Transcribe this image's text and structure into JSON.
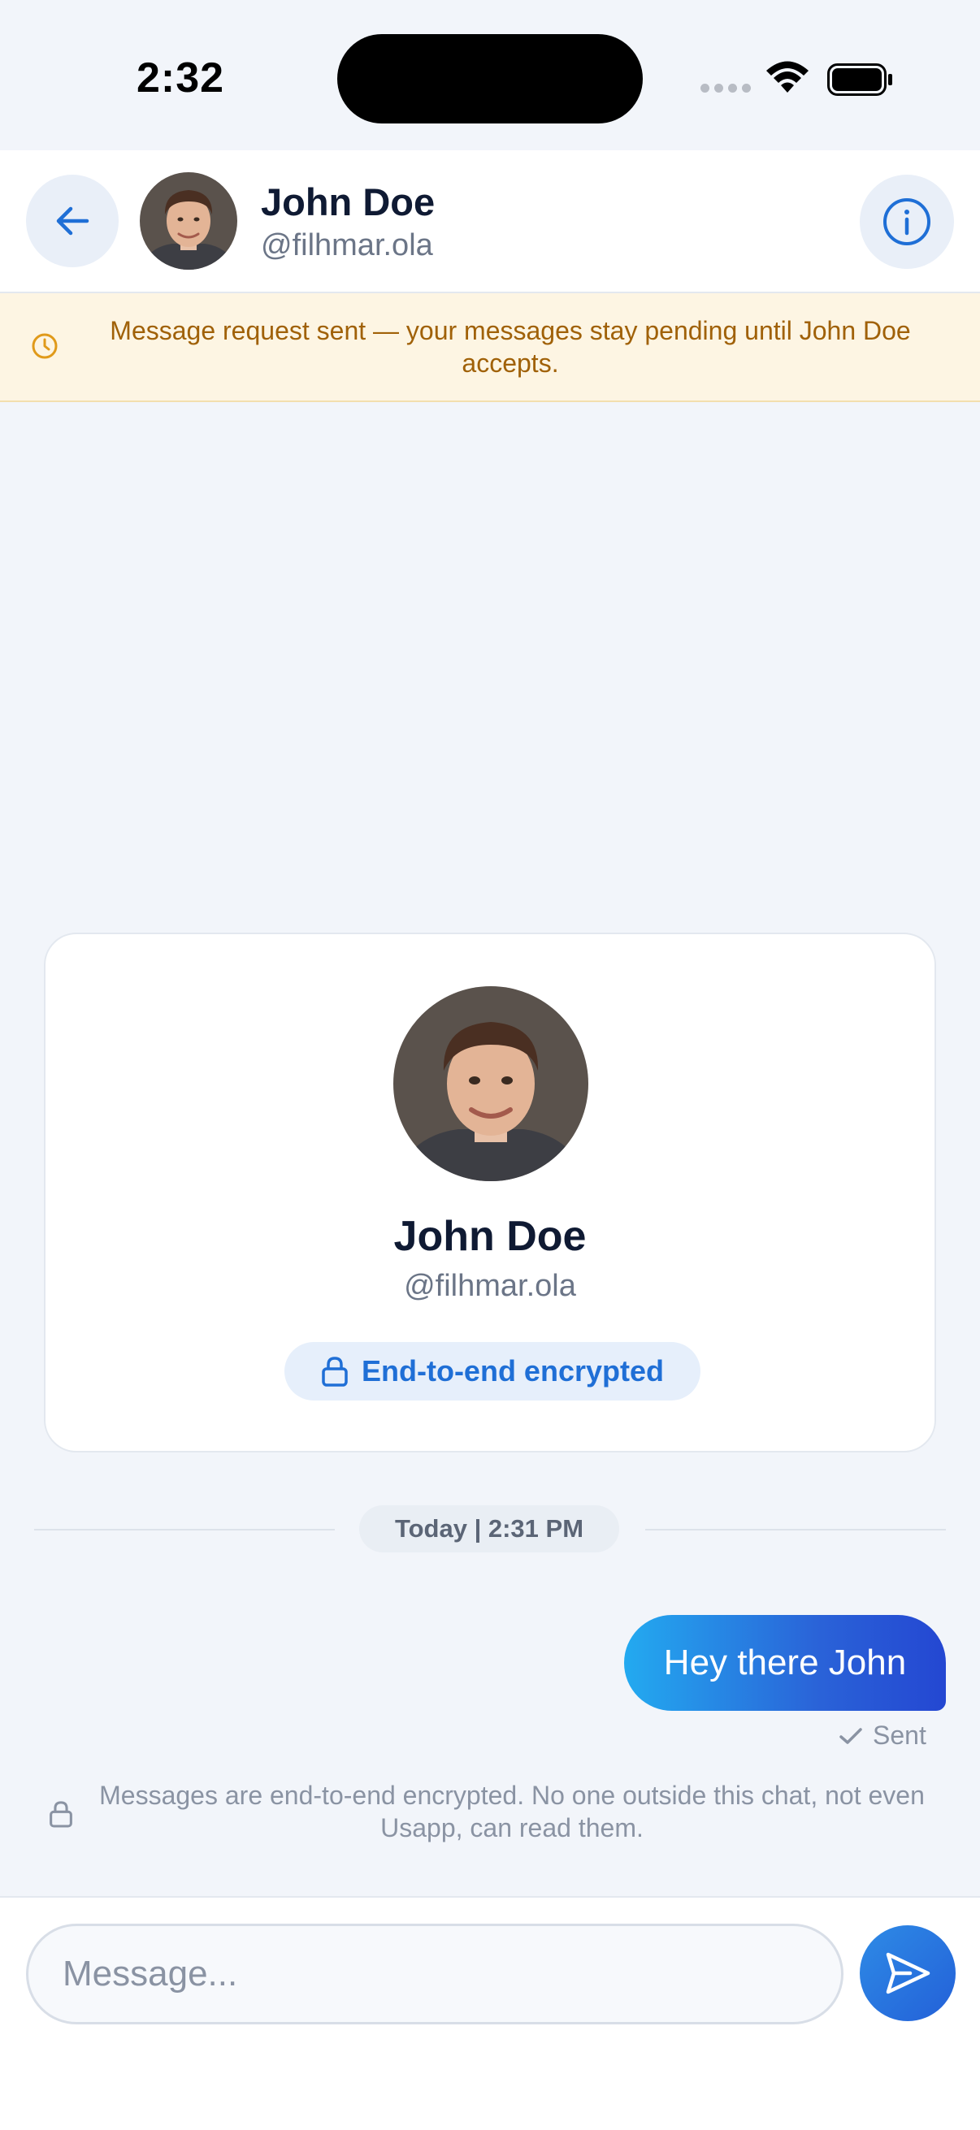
{
  "status_bar": {
    "time": "2:32"
  },
  "header": {
    "name": "John Doe",
    "handle": "@filhmar.ola",
    "back_icon": "arrow-left-icon",
    "info_icon": "info-icon"
  },
  "banner": {
    "text": "Message request sent — your messages stay pending until John Doe accepts.",
    "icon": "clock-icon"
  },
  "profile_card": {
    "name": "John Doe",
    "handle": "@filhmar.ola",
    "encryption_label": "End-to-end encrypted"
  },
  "date_divider": "Today | 2:31 PM",
  "messages": [
    {
      "text": "Hey there John",
      "direction": "outgoing",
      "status": "Sent"
    }
  ],
  "encryption_notice": "Messages are end-to-end encrypted. No one outside this chat, not even Usapp, can read them.",
  "composer": {
    "placeholder": "Message...",
    "value": ""
  },
  "colors": {
    "accent": "#2a63d8",
    "banner_text": "#a06108",
    "banner_bg": "#fdf5e3"
  }
}
